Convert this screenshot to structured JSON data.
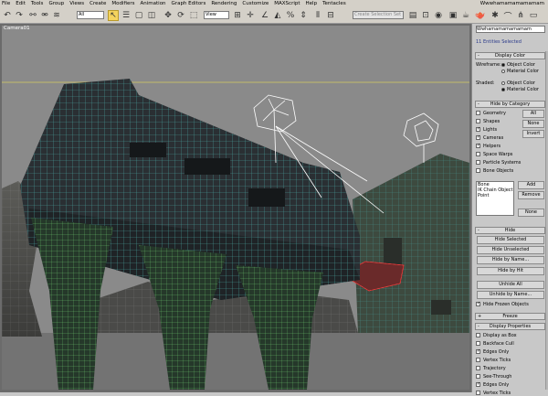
{
  "window": {
    "title": "Wwwhamamamamamam"
  },
  "menu": [
    "File",
    "Edit",
    "Tools",
    "Group",
    "Views",
    "Create",
    "Modifiers",
    "Animation",
    "Graph Editors",
    "Rendering",
    "Customize",
    "MAXScript",
    "Help",
    "Tentacles"
  ],
  "toolbar": {
    "filter_value": "All",
    "view_value": "View",
    "selection_set_placeholder": "Create Selection Set"
  },
  "viewport": {
    "label": "Camera01"
  },
  "panel": {
    "object_name": "Wwhamamamamamam",
    "entities_selected": "11 Entities Selected",
    "display_color": {
      "title": "Display Color",
      "wireframe_label": "Wireframe:",
      "shaded_label": "Shaded:",
      "object_color": "Object Color",
      "material_color": "Material Color"
    },
    "hide_by_category": {
      "title": "Hide by Category",
      "items": [
        {
          "label": "Geometry",
          "checked": false
        },
        {
          "label": "Shapes",
          "checked": false
        },
        {
          "label": "Lights",
          "checked": true
        },
        {
          "label": "Cameras",
          "checked": true
        },
        {
          "label": "Helpers",
          "checked": true
        },
        {
          "label": "Space Warps",
          "checked": false
        },
        {
          "label": "Particle Systems",
          "checked": false
        },
        {
          "label": "Bone Objects",
          "checked": false
        }
      ],
      "all": "All",
      "none": "None",
      "invert": "Invert",
      "list_items": [
        "Bone",
        "IK Chain Object",
        "Point"
      ],
      "add": "Add",
      "remove": "Remove",
      "none2": "None"
    },
    "hide": {
      "title": "Hide",
      "buttons": [
        "Hide Selected",
        "Hide Unselected",
        "Hide by Name...",
        "Hide by Hit",
        "Unhide All",
        "Unhide by Name..."
      ],
      "hide_frozen": "Hide Frozen Objects"
    },
    "freeze": {
      "title": "Freeze"
    },
    "display_properties": {
      "title": "Display Properties",
      "items": [
        {
          "label": "Display as Box",
          "checked": false
        },
        {
          "label": "Backface Cull",
          "checked": false
        },
        {
          "label": "Edges Only",
          "checked": true
        },
        {
          "label": "Vertex Ticks",
          "checked": false
        },
        {
          "label": "Trajectory",
          "checked": false
        },
        {
          "label": "See-Through",
          "checked": false
        },
        {
          "label": "Edges Only",
          "checked": true
        },
        {
          "label": "Vertex Ticks",
          "checked": false
        }
      ]
    }
  }
}
